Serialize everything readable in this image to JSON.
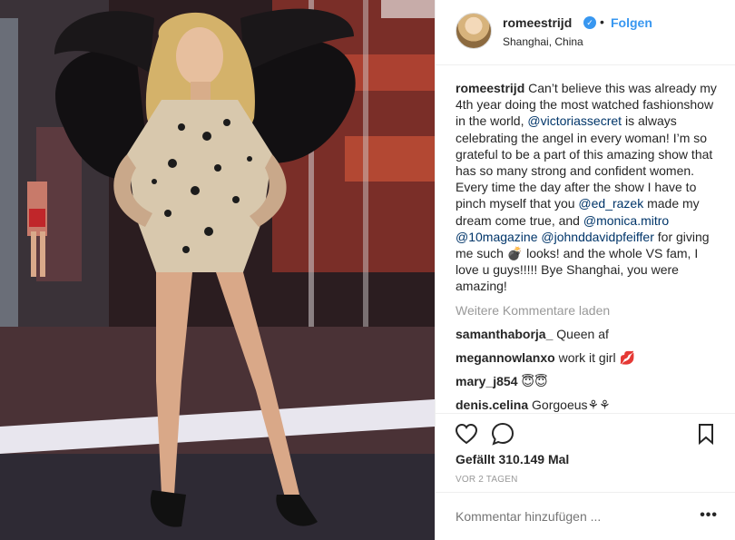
{
  "post": {
    "username": "romeestrijd",
    "follow_label": "Folgen",
    "dot": "•",
    "location": "Shanghai, China",
    "verified_icon": "verified-badge-icon",
    "image_alt": "runway-photo"
  },
  "caption": {
    "username": "romeestrijd",
    "text_1": " Can’t believe this was already my 4th year doing the most watched fashionshow in the world, ",
    "mention_1": "@victoriassecret",
    "text_2": " is always celebrating the angel in every woman! I’m so grateful to be a part of this amazing show that has so many strong and confident women. Every time the day after the show I have to pinch myself that you ",
    "mention_2": "@ed_razek",
    "text_3": " made my dream come true, and ",
    "mention_3": "@monica.mitro",
    "text_4": " ",
    "mention_4": "@10magazine",
    "text_5": " ",
    "mention_5": "@johnddavidpfeiffer",
    "text_6": " for giving me such 💣 looks! and the whole VS fam, I love u guys!!!!! Bye Shanghai, you were amazing!"
  },
  "load_more_label": "Weitere Kommentare laden",
  "comments": [
    {
      "user": "samanthaborja_",
      "text": " Queen af"
    },
    {
      "user": "megannowlanxo",
      "text": " work it girl 💋"
    },
    {
      "user": "mary_j854",
      "text": " 😇😇"
    },
    {
      "user": "denis.celina",
      "text": " Gorgoeus⚘⚘"
    }
  ],
  "actions": {
    "like_icon": "heart-icon",
    "comment_icon": "comment-icon",
    "save_icon": "bookmark-icon",
    "likes_text": "Gefällt 310.149 Mal",
    "time_text": "VOR 2 TAGEN"
  },
  "comment_box": {
    "placeholder": "Kommentar hinzufügen ...",
    "more_label": "•••"
  }
}
